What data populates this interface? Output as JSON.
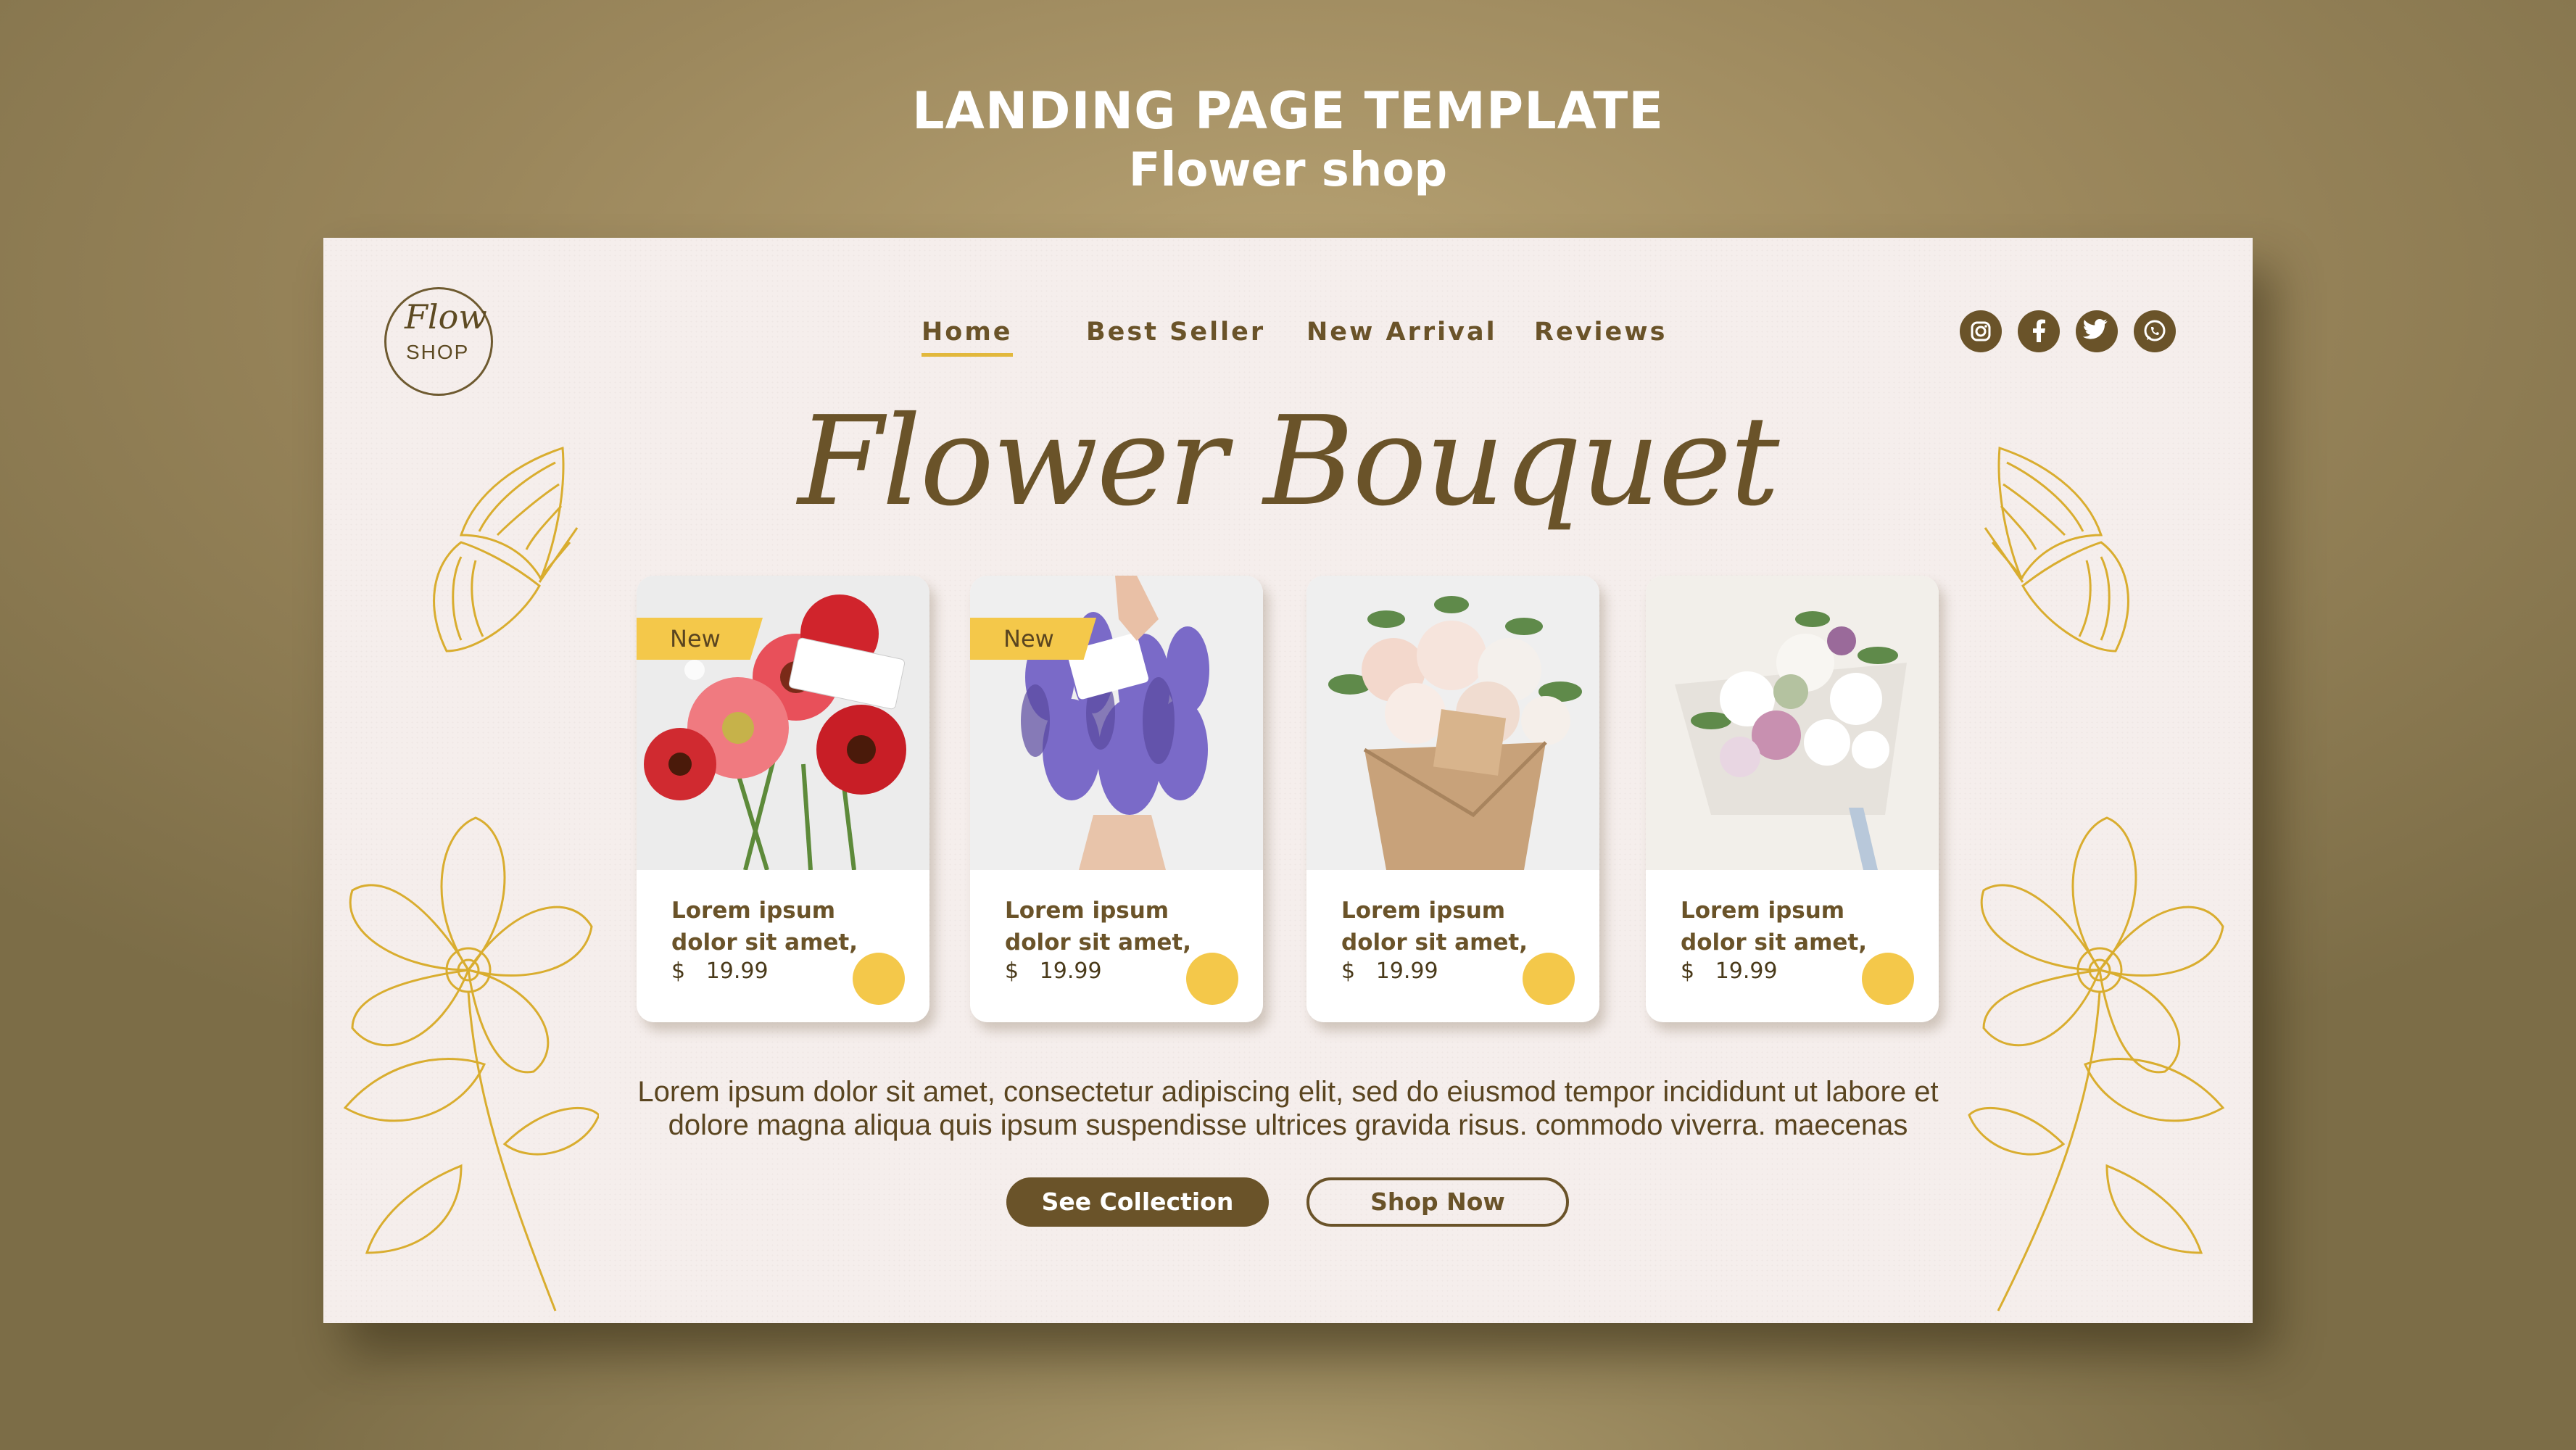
{
  "poster": {
    "title": "LANDING PAGE TEMPLATE",
    "subtitle": "Flower shop"
  },
  "logo": {
    "script": "Flow",
    "word": "SHOP"
  },
  "nav": {
    "items": [
      {
        "label": "Home",
        "active": true
      },
      {
        "label": "Best Seller",
        "active": false
      },
      {
        "label": "New Arrival",
        "active": false
      },
      {
        "label": "Reviews",
        "active": false
      }
    ]
  },
  "social": [
    "instagram-icon",
    "facebook-icon",
    "twitter-icon",
    "whatsapp-icon"
  ],
  "hero": {
    "title": "Flower Bouquet"
  },
  "products": [
    {
      "badge": "New",
      "name_line1": "Lorem ipsum",
      "name_line2": "dolor sit amet,",
      "price": "$   19.99",
      "photo": "red-gerbera-bouquet"
    },
    {
      "badge": "New",
      "name_line1": "Lorem ipsum",
      "name_line2": "dolor sit amet,",
      "price": "$   19.99",
      "photo": "lavender-bouquet"
    },
    {
      "badge": "",
      "name_line1": "Lorem ipsum",
      "name_line2": "dolor sit amet,",
      "price": "$   19.99",
      "photo": "rose-kraft-bouquet"
    },
    {
      "badge": "",
      "name_line1": "Lorem ipsum",
      "name_line2": "dolor sit amet,",
      "price": "$   19.99",
      "photo": "mixed-white-bouquet"
    }
  ],
  "description": {
    "line1": "Lorem ipsum dolor sit amet, consectetur adipiscing elit, sed do eiusmod tempor incididunt ut labore et",
    "line2": "dolore magna aliqua quis ipsum suspendisse ultrices gravida risus. commodo viverra. maecenas"
  },
  "buttons": {
    "primary": "See Collection",
    "secondary": "Shop Now"
  },
  "colors": {
    "accent": "#f4c84a",
    "brand": "#6a5329",
    "canvas": "#f5eeec"
  }
}
